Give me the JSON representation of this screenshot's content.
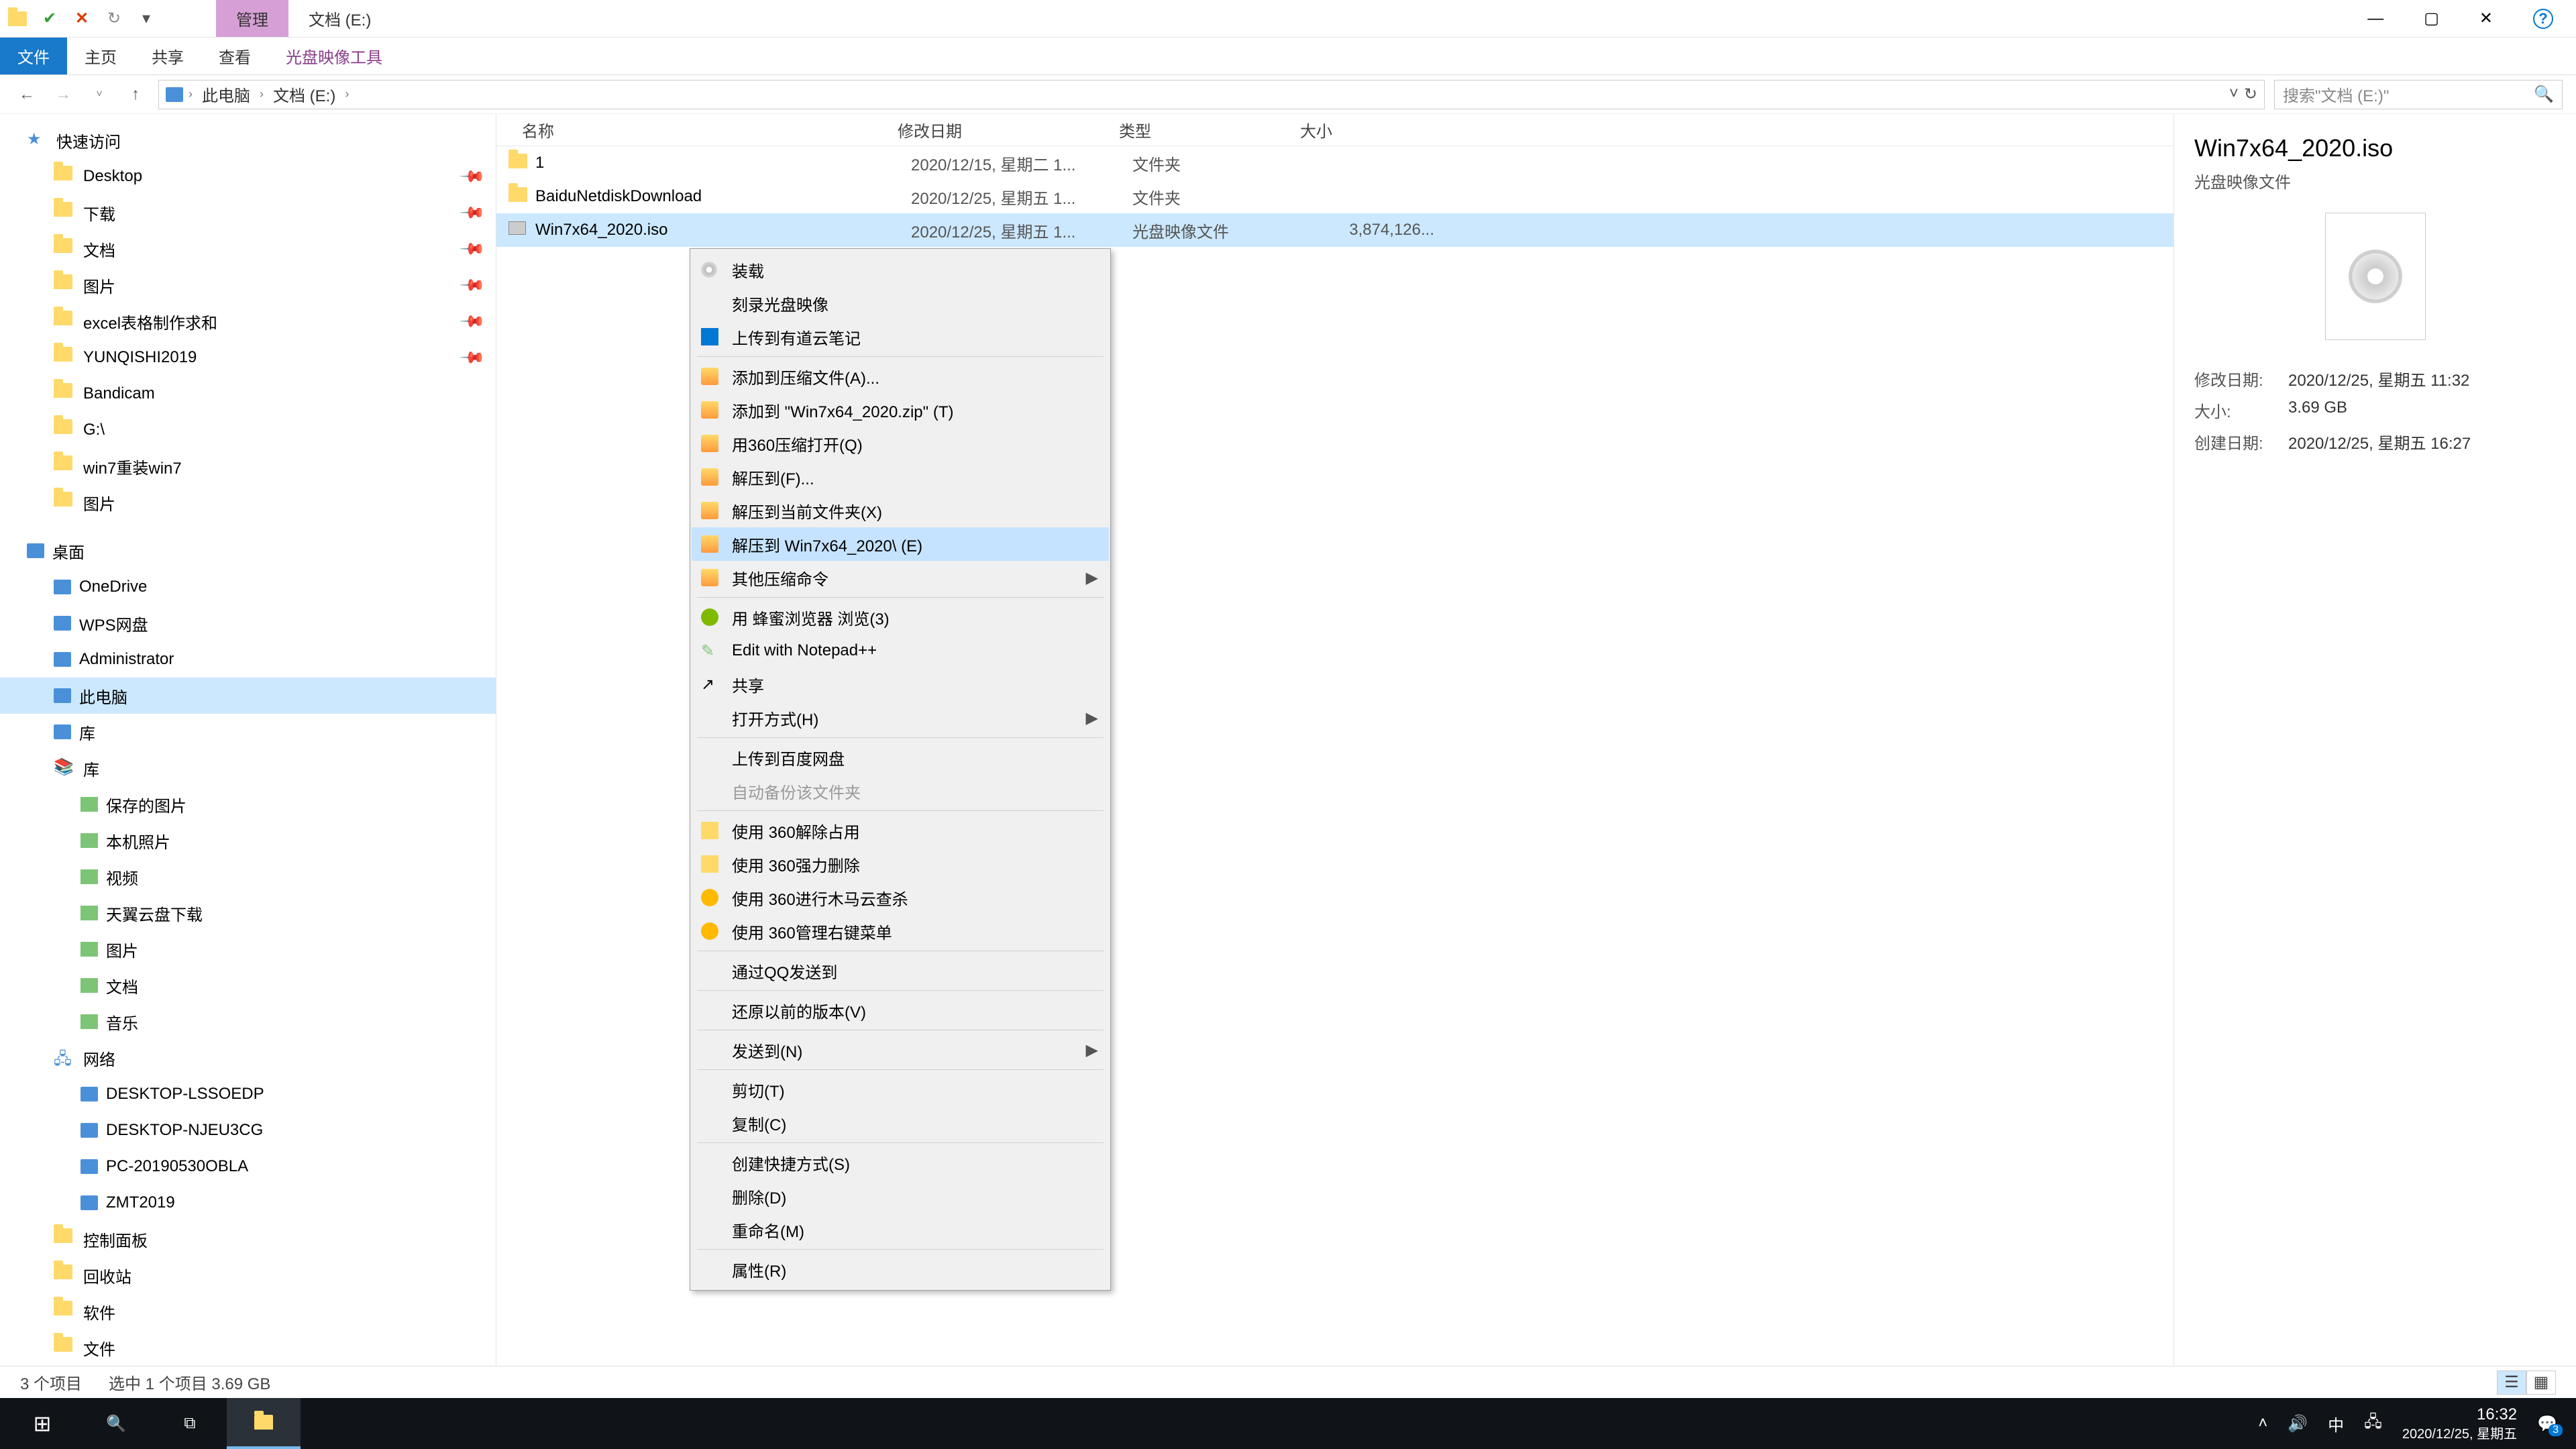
{
  "titlebar": {
    "tabs": {
      "context": "管理",
      "title": "文档 (E:)"
    },
    "win": {
      "min": "—",
      "max": "▢",
      "close": "✕",
      "help": "?"
    }
  },
  "ribbon": {
    "file": "文件",
    "home": "主页",
    "share": "共享",
    "view": "查看",
    "tool": "光盘映像工具"
  },
  "address": {
    "crumbs": [
      "此电脑",
      "文档 (E:)"
    ],
    "search_ph": "搜索\"文档 (E:)\""
  },
  "tree": {
    "quick": "快速访问",
    "quick_items": [
      "Desktop",
      "下载",
      "文档",
      "图片",
      "excel表格制作求和",
      "YUNQISHI2019",
      "Bandicam",
      "G:\\",
      "win7重装win7",
      "图片"
    ],
    "desktop": "桌面",
    "desktop_items": [
      "OneDrive",
      "WPS网盘",
      "Administrator",
      "此电脑",
      "库"
    ],
    "lib_items": [
      "保存的图片",
      "本机照片",
      "视频",
      "天翼云盘下载",
      "图片",
      "文档",
      "音乐"
    ],
    "network": "网络",
    "net_items": [
      "DESKTOP-LSSOEDP",
      "DESKTOP-NJEU3CG",
      "PC-20190530OBLA",
      "ZMT2019"
    ],
    "others": [
      "控制面板",
      "回收站",
      "软件",
      "文件"
    ]
  },
  "columns": {
    "name": "名称",
    "date": "修改日期",
    "type": "类型",
    "size": "大小"
  },
  "files": [
    {
      "name": "1",
      "date": "2020/12/15, 星期二 1...",
      "type": "文件夹",
      "size": ""
    },
    {
      "name": "BaiduNetdiskDownload",
      "date": "2020/12/25, 星期五 1...",
      "type": "文件夹",
      "size": ""
    },
    {
      "name": "Win7x64_2020.iso",
      "date": "2020/12/25, 星期五 1...",
      "type": "光盘映像文件",
      "size": "3,874,126..."
    }
  ],
  "ctx": [
    {
      "t": "装载",
      "i": "disc"
    },
    {
      "t": "刻录光盘映像"
    },
    {
      "t": "上传到有道云笔记",
      "i": "blue"
    },
    {
      "sep": true
    },
    {
      "t": "添加到压缩文件(A)...",
      "i": "arc"
    },
    {
      "t": "添加到 \"Win7x64_2020.zip\" (T)",
      "i": "arc"
    },
    {
      "t": "用360压缩打开(Q)",
      "i": "arc"
    },
    {
      "t": "解压到(F)...",
      "i": "arc"
    },
    {
      "t": "解压到当前文件夹(X)",
      "i": "arc"
    },
    {
      "t": "解压到 Win7x64_2020\\ (E)",
      "i": "arc",
      "hov": true
    },
    {
      "t": "其他压缩命令",
      "i": "arc",
      "sub": true
    },
    {
      "sep": true
    },
    {
      "t": "用 蜂蜜浏览器 浏览(3)",
      "i": "green"
    },
    {
      "t": "Edit with Notepad++",
      "i": "npp"
    },
    {
      "t": "共享",
      "i": "share"
    },
    {
      "t": "打开方式(H)",
      "sub": true
    },
    {
      "sep": true
    },
    {
      "t": "上传到百度网盘"
    },
    {
      "t": "自动备份该文件夹",
      "disabled": true
    },
    {
      "sep": true
    },
    {
      "t": "使用 360解除占用",
      "i": "y"
    },
    {
      "t": "使用 360强力删除",
      "i": "y"
    },
    {
      "t": "使用 360进行木马云查杀",
      "i": "yc"
    },
    {
      "t": "使用 360管理右键菜单",
      "i": "yc"
    },
    {
      "sep": true
    },
    {
      "t": "通过QQ发送到"
    },
    {
      "sep": true
    },
    {
      "t": "还原以前的版本(V)"
    },
    {
      "sep": true
    },
    {
      "t": "发送到(N)",
      "sub": true
    },
    {
      "sep": true
    },
    {
      "t": "剪切(T)"
    },
    {
      "t": "复制(C)"
    },
    {
      "sep": true
    },
    {
      "t": "创建快捷方式(S)"
    },
    {
      "t": "删除(D)"
    },
    {
      "t": "重命名(M)"
    },
    {
      "sep": true
    },
    {
      "t": "属性(R)"
    }
  ],
  "details": {
    "title": "Win7x64_2020.iso",
    "subtitle": "光盘映像文件",
    "rows": [
      {
        "l": "修改日期:",
        "v": "2020/12/25, 星期五 11:32"
      },
      {
        "l": "大小:",
        "v": "3.69 GB"
      },
      {
        "l": "创建日期:",
        "v": "2020/12/25, 星期五 16:27"
      }
    ]
  },
  "status": {
    "count": "3 个项目",
    "sel": "选中 1 个项目  3.69 GB"
  },
  "taskbar": {
    "ime": "中",
    "time": "16:32",
    "date": "2020/12/25, 星期五",
    "badge": "3"
  }
}
